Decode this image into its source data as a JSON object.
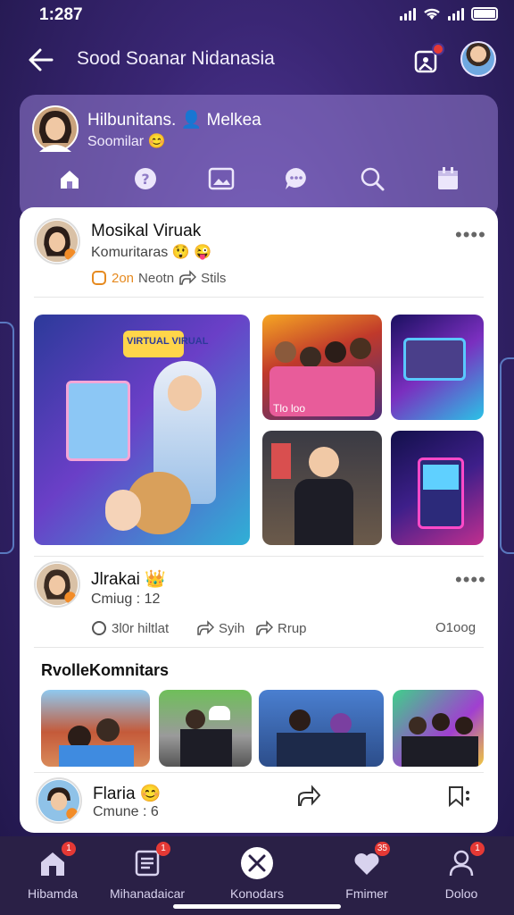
{
  "status_bar": {
    "time": "1:287"
  },
  "header": {
    "title": "Sood Soanar Nidanasia"
  },
  "profile": {
    "name": "Hilbunitans. 👤 Melkea",
    "subtitle": "Soomilar 😊"
  },
  "profile_tabs": [
    {
      "icon": "home-icon"
    },
    {
      "icon": "help-icon"
    },
    {
      "icon": "image-icon"
    },
    {
      "icon": "chat-icon"
    },
    {
      "icon": "search-icon"
    },
    {
      "icon": "calendar-icon"
    }
  ],
  "posts": [
    {
      "name": "Mosikal Viruak",
      "subtitle": "Komuritaras 😲 😜",
      "more": "••••",
      "actions": {
        "comment_count": "2on",
        "comment_label": "Neotn",
        "share": "Stils"
      },
      "tiles": [
        {
          "label": "VIRTUAL VIRUAL",
          "caption": ""
        },
        {
          "label": "",
          "caption": "Tlo loo"
        },
        {
          "label": "",
          "caption": ""
        },
        {
          "label": "",
          "caption": ""
        },
        {
          "label": "",
          "caption": ""
        }
      ]
    },
    {
      "name": "Jlrakai 👑",
      "subtitle": "Cmiug : 12",
      "more": "••••",
      "actions": {
        "comment": "3l0r hiltlat",
        "like": "Syih",
        "share": "Rrup",
        "count": "O1oog"
      }
    }
  ],
  "community": {
    "title": "RvolleKomnitars"
  },
  "footer_post": {
    "name": "Flaria 😊",
    "subtitle": "Cmune : 6"
  },
  "bottom_nav": [
    {
      "label": "Hibamda",
      "badge": "1"
    },
    {
      "label": "Mihanadaicar",
      "badge": "1"
    },
    {
      "label": "Konodars",
      "badge": ""
    },
    {
      "label": "Fmimer",
      "badge": "35"
    },
    {
      "label": "Doloo",
      "badge": "1"
    }
  ],
  "colors": {
    "accent": "#e53935",
    "background": "#3a2674",
    "card": "#ffffff"
  }
}
